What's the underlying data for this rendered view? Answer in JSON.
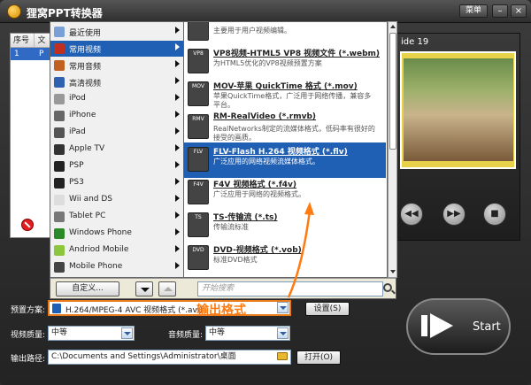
{
  "app": {
    "title": "狸窝PPT转换器",
    "menu_label": "菜单",
    "min": "–",
    "close": "×"
  },
  "file_list": {
    "headers": [
      "序号",
      "文"
    ],
    "rows": [
      {
        "index": "1",
        "name": "P"
      }
    ],
    "remove_label": "移"
  },
  "preview": {
    "slide_label": "ide 19",
    "controls": [
      "◀◀",
      "▶▶",
      "■"
    ]
  },
  "categories": [
    {
      "label": "最近使用",
      "color": "#7aa0d8"
    },
    {
      "label": "常用视频",
      "color": "#c03020"
    },
    {
      "label": "常用音频",
      "color": "#c06020"
    },
    {
      "label": "高清视频",
      "color": "#3060b0"
    },
    {
      "label": "iPod",
      "color": "#999999"
    },
    {
      "label": "iPhone",
      "color": "#666666"
    },
    {
      "label": "iPad",
      "color": "#555555"
    },
    {
      "label": "Apple TV",
      "color": "#333333"
    },
    {
      "label": "PSP",
      "color": "#222222"
    },
    {
      "label": "PS3",
      "color": "#222222"
    },
    {
      "label": "Wii and DS",
      "color": "#dddddd"
    },
    {
      "label": "Tablet PC",
      "color": "#777777"
    },
    {
      "label": "Windows Phone",
      "color": "#2a8a2a"
    },
    {
      "label": "Andriod Mobile",
      "color": "#8cc63f"
    },
    {
      "label": "Mobile Phone",
      "color": "#444444"
    }
  ],
  "selected_category": "常用视频",
  "formats": [
    {
      "icon": "",
      "title": "",
      "desc": "主要用于用户视频编辑。"
    },
    {
      "icon": "VP8",
      "title": "VP8视频-HTML5 VP8 视频文件 (*.webm)",
      "desc": "为HTML5优化的VP8视频预置方案"
    },
    {
      "icon": "MOV",
      "title": "MOV-苹果 QuickTime 格式 (*.mov)",
      "desc": "苹果QuickTime格式，广泛用于网络传播，兼容多平台。"
    },
    {
      "icon": "RMV",
      "title": "RM-RealVideo (*.rmvb)",
      "desc": "RealNetworks制定的流媒体格式，低码率有很好的接受的画质。"
    },
    {
      "icon": "FLV",
      "title": "FLV-Flash H.264 视频格式 (*.flv)",
      "desc": "广泛应用的网络视频流媒体格式。"
    },
    {
      "icon": "F4V",
      "title": "F4V 视频格式 (*.f4v)",
      "desc": "广泛应用于网络的视频格式。"
    },
    {
      "icon": "TS",
      "title": "TS-传输流 (*.ts)",
      "desc": "传输流标准"
    },
    {
      "icon": "DVD",
      "title": "DVD-视频格式 (*.vob)",
      "desc": "标准DVD格式"
    }
  ],
  "selected_format_index": 4,
  "menu_bottom": {
    "custom_label": "自定义...",
    "search_placeholder": "开始搜索"
  },
  "settings": {
    "preset_label": "预置方案:",
    "preset_value": "H.264/MPEG-4 AVC 视频格式 (*.avi)",
    "output_format_annotation": "输出格式",
    "settings_button": "设置(S)",
    "video_quality_label": "视频质量:",
    "video_quality_value": "中等",
    "audio_quality_label": "音频质量:",
    "audio_quality_value": "中等",
    "output_path_label": "输出路径:",
    "output_path_value": "C:\\Documents and Settings\\Administrator\\桌面",
    "open_button": "打开(O)",
    "start_label": "Start"
  },
  "colors": {
    "accent_orange": "#e87a1a",
    "selection_blue": "#1f5fb4"
  }
}
